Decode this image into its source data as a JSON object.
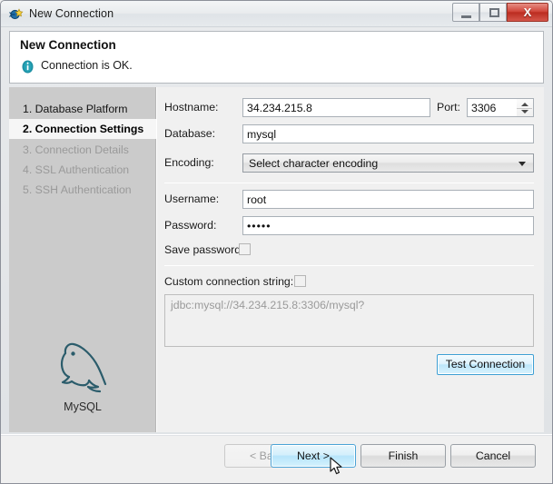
{
  "window": {
    "title": "New Connection",
    "icon": "connection-wizard-icon",
    "controls": {
      "minimize": "minimize-icon",
      "maximize": "maximize-icon",
      "close_label": "X"
    }
  },
  "banner": {
    "title": "New Connection",
    "status_icon": "info-icon",
    "status_message": "Connection is OK."
  },
  "sidebar": {
    "steps": [
      {
        "label": "1. Database Platform",
        "state": "done"
      },
      {
        "label": "2. Connection Settings",
        "state": "active"
      },
      {
        "label": "3. Connection Details",
        "state": "disabled"
      },
      {
        "label": "4. SSL Authentication",
        "state": "disabled"
      },
      {
        "label": "5. SSH Authentication",
        "state": "disabled"
      }
    ],
    "platform": {
      "logo_icon": "mysql-dolphin-icon",
      "label": "MySQL"
    }
  },
  "form": {
    "hostname": {
      "label": "Hostname:",
      "value": "34.234.215.8",
      "placeholder": ""
    },
    "port": {
      "label": "Port:",
      "value": "3306",
      "placeholder": ""
    },
    "database": {
      "label": "Database:",
      "value": "mysql",
      "placeholder": ""
    },
    "encoding": {
      "label": "Encoding:",
      "value": "Select character encoding"
    },
    "username": {
      "label": "Username:",
      "value": "root",
      "placeholder": ""
    },
    "password": {
      "label": "Password:",
      "value": "•••••",
      "placeholder": ""
    },
    "save_password": {
      "label": "Save password:",
      "checked": false
    },
    "custom_connection_string": {
      "label": "Custom connection string:",
      "checked": false
    },
    "connection_string": {
      "value": "jdbc:mysql://34.234.215.8:3306/mysql?"
    },
    "test_connection_label": "Test Connection"
  },
  "footer": {
    "back": "< Back",
    "next": "Next >",
    "finish": "Finish",
    "cancel": "Cancel"
  },
  "colors": {
    "accent": "#3c9fd4",
    "info": "#1a8fa0",
    "close": "#bb2c20",
    "sidebar_bg": "#cbcbcb",
    "content_bg": "#f0f0f0"
  }
}
